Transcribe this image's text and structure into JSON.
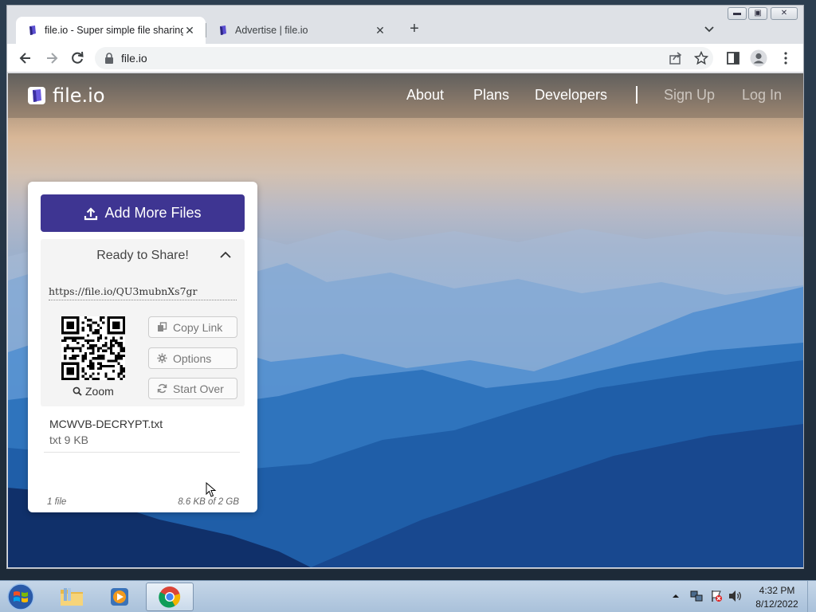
{
  "browser": {
    "tabs": [
      {
        "title": "file.io - Super simple file sharing",
        "active": true
      },
      {
        "title": "Advertise | file.io",
        "active": false
      }
    ],
    "window_buttons": {
      "minimize": "▬",
      "maximize": "▣",
      "close": "✕"
    },
    "url": "file.io",
    "icons": [
      "back-icon",
      "forward-icon",
      "reload-icon",
      "lock-icon",
      "share-icon",
      "star-icon",
      "side-panel-icon",
      "profile-icon",
      "menu-icon"
    ]
  },
  "site": {
    "logo_text": "file.io",
    "nav": {
      "about": "About",
      "plans": "Plans",
      "developers": "Developers",
      "sign_up": "Sign Up",
      "log_in": "Log In"
    },
    "accent_color": "#3e3592"
  },
  "upload": {
    "add_button": "Add More Files",
    "ready_title": "Ready to Share!",
    "link": "https://file.io/QU3mubnXs7gr",
    "zoom": "Zoom",
    "copy_link": "Copy Link",
    "options": "Options",
    "start_over": "Start Over",
    "file": {
      "name": "MCWVB-DECRYPT.txt",
      "meta": "txt 9 KB"
    },
    "file_count": "1 file",
    "usage": "8.6 KB of 2 GB"
  },
  "taskbar": {
    "apps": [
      "windows-start",
      "file-explorer",
      "media-player",
      "chrome"
    ],
    "clock": {
      "time": "4:32 PM",
      "date": "8/12/2022"
    }
  }
}
